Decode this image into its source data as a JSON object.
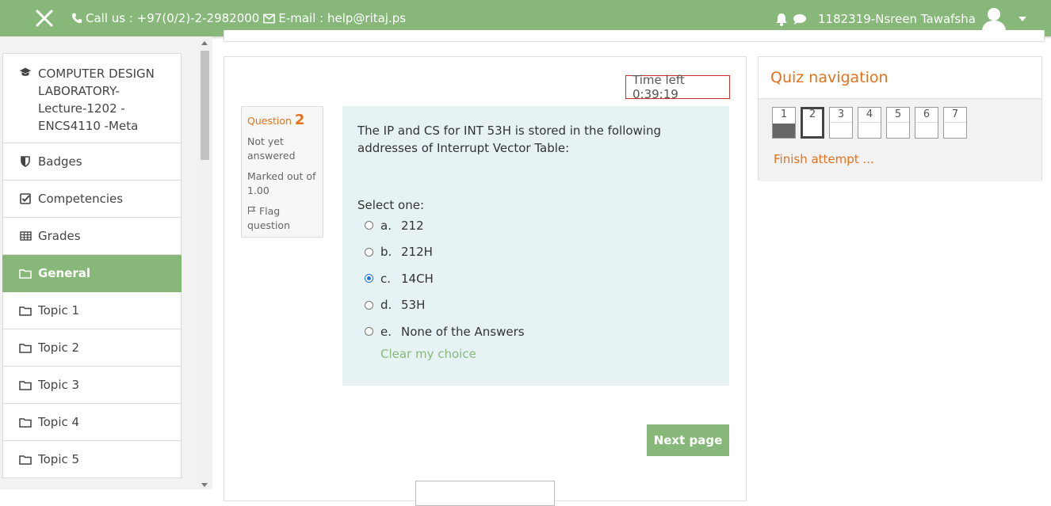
{
  "topbar": {
    "call": "Call us : +97(0/2)-2-2982000",
    "email": "E-mail : help@ritaj.ps",
    "user_name": "1182319-Nsreen Tawafsha",
    "bg_color": "#87b87a"
  },
  "sidebar": {
    "course_lines": [
      "COMPUTER DESIGN",
      "LABORATORY-",
      "Lecture-1202 -",
      "ENCS4110 -Meta"
    ],
    "items": [
      {
        "label": "Badges",
        "icon": "shield-icon"
      },
      {
        "label": "Competencies",
        "icon": "checkbox-icon"
      },
      {
        "label": "Grades",
        "icon": "table-icon"
      },
      {
        "label": "General",
        "icon": "folder-icon",
        "active": true
      },
      {
        "label": "Topic 1",
        "icon": "folder-icon"
      },
      {
        "label": "Topic 2",
        "icon": "folder-icon"
      },
      {
        "label": "Topic 3",
        "icon": "folder-icon"
      },
      {
        "label": "Topic 4",
        "icon": "folder-icon"
      },
      {
        "label": "Topic 5",
        "icon": "folder-icon"
      }
    ]
  },
  "quiz": {
    "timer": "Time left 0:39:19",
    "question_label": "Question",
    "question_number": "2",
    "status": "Not yet answered",
    "marked_out_of": "Marked out of 1.00",
    "flag_label": "Flag question",
    "question_text": "The IP and CS for INT 53H is stored in the following addresses of Interrupt Vector Table:",
    "select_one": "Select one:",
    "options": [
      {
        "letter": "a.",
        "text": "212"
      },
      {
        "letter": "b.",
        "text": "212H"
      },
      {
        "letter": "c.",
        "text": "14CH",
        "selected": true
      },
      {
        "letter": "d.",
        "text": "53H"
      },
      {
        "letter": "e.",
        "text": "None of the Answers"
      }
    ],
    "clear_choice": "Clear my choice",
    "next_page": "Next page"
  },
  "quiz_nav": {
    "title": "Quiz navigation",
    "buttons": [
      {
        "label": "1",
        "state": "answered"
      },
      {
        "label": "2",
        "state": "current"
      },
      {
        "label": "3",
        "state": "unanswered"
      },
      {
        "label": "4",
        "state": "unanswered"
      },
      {
        "label": "5",
        "state": "unanswered"
      },
      {
        "label": "6",
        "state": "unanswered"
      },
      {
        "label": "7",
        "state": "unanswered"
      }
    ],
    "finish_attempt": "Finish attempt ..."
  }
}
